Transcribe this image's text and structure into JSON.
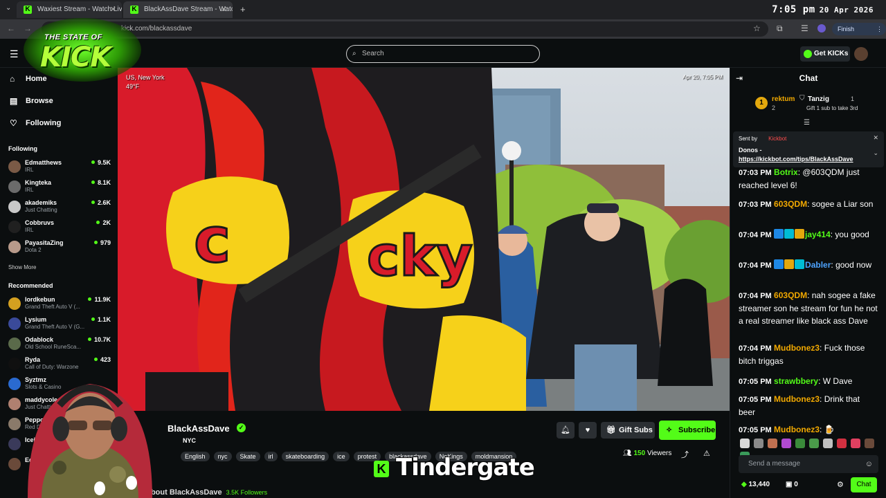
{
  "browser": {
    "tabs": [
      {
        "title": "Waxiest Stream - Watch Live"
      },
      {
        "title": "BlackAssDave Stream - Watch L"
      }
    ],
    "url": "kick.com/blackassdave",
    "finish_update": "Finish update",
    "clock_time": "7:05 pm",
    "clock_date": "20 Apr 2026"
  },
  "overlay_logo": {
    "top": "THE STATE OF",
    "big": "KICK"
  },
  "header": {
    "search_placeholder": "Search",
    "get_kicks": "Get KICKs"
  },
  "sidebar": {
    "nav": [
      {
        "label": "Home",
        "icon": "home-icon"
      },
      {
        "label": "Browse",
        "icon": "browse-icon"
      },
      {
        "label": "Following",
        "icon": "heart-icon"
      }
    ],
    "following_title": "Following",
    "following": [
      {
        "name": "Edmatthews",
        "category": "IRL",
        "viewers": "9.5K",
        "color": "#7a5a46"
      },
      {
        "name": "Kingteka",
        "category": "IRL",
        "viewers": "8.1K",
        "color": "#6b6b6b"
      },
      {
        "name": "akademiks",
        "category": "Just Chatting",
        "viewers": "2.6K",
        "color": "#c8c8c8"
      },
      {
        "name": "Cobbruvs",
        "category": "IRL",
        "viewers": "2K",
        "color": "#202020"
      },
      {
        "name": "PayasitaZing",
        "category": "Dota 2",
        "viewers": "979",
        "color": "#b89a8a"
      }
    ],
    "show_more": "Show More",
    "recommended_title": "Recommended",
    "recommended": [
      {
        "name": "lordkebun",
        "category": "Grand Theft Auto V (...",
        "viewers": "11.9K",
        "color": "#d4a020"
      },
      {
        "name": "Lysium",
        "category": "Grand Theft Auto V (G...",
        "viewers": "1.1K",
        "color": "#3a4a9a"
      },
      {
        "name": "Odablock",
        "category": "Old School RuneSca...",
        "viewers": "10.7K",
        "color": "#5a6a4a"
      },
      {
        "name": "Ryda",
        "category": "Call of Duty: Warzone",
        "viewers": "423",
        "color": "#101010"
      },
      {
        "name": "Syztmz",
        "category": "Slots & Casino",
        "viewers": "",
        "color": "#2a6ad0"
      },
      {
        "name": "maddycoles",
        "category": "Just Chatting",
        "viewers": "",
        "color": "#b08070"
      },
      {
        "name": "Peppo",
        "category": "Red Dead...",
        "viewers": "",
        "color": "#8a7a6a"
      },
      {
        "name": "Iceing",
        "category": "",
        "viewers": "",
        "color": "#3a3a5a"
      },
      {
        "name": "Ed",
        "category": "",
        "viewers": "",
        "color": "#6a4a3a"
      }
    ]
  },
  "video": {
    "location": "US, New York",
    "temp": "49°F",
    "timestamp": "Apr 20, 7:05 PM"
  },
  "stream": {
    "streamer": "BlackAssDave",
    "title": "NYC",
    "tags": [
      "English",
      "nyc",
      "Skate",
      "irl",
      "skateboarding",
      "ice",
      "protest",
      "blackassdave",
      "NoKings",
      "moldmansion"
    ],
    "gift_subs": "Gift Subs",
    "subscribe": "Subscribe",
    "viewers_count": "150",
    "viewers_label": "Viewers",
    "about": "About BlackAssDave",
    "followers": "3.5K Followers"
  },
  "caption": "Tindergate",
  "chat": {
    "title": "Chat",
    "leaderboard": [
      {
        "rank": "1",
        "name": "rektum",
        "count": "2"
      },
      {
        "name": "Tanzig",
        "count": "1",
        "note": "Gift 1 sub to take 3rd"
      }
    ],
    "pinned": {
      "sent_by": "Sent by",
      "bot_name": "Kickbot",
      "donos": "Donos -",
      "link": "https://kickbot.com/tips/BlackAssDave"
    },
    "messages": [
      {
        "time": "07:03 PM",
        "user": "Botrix",
        "color": "#53fc18",
        "text": "@603QDM just reached level 6!",
        "badges": []
      },
      {
        "time": "07:03 PM",
        "user": "603QDM",
        "color": "#f2a900",
        "text": "sogee a Liar son",
        "badges": []
      },
      {
        "time": "07:04 PM",
        "user": "jay414",
        "color": "#53fc18",
        "text": "you good",
        "badges": [
          "#1e88e5",
          "#00bcd4",
          "#e3a80d"
        ]
      },
      {
        "time": "07:04 PM",
        "user": "Dabler",
        "color": "#4da3ff",
        "text": "good now",
        "badges": [
          "#1e88e5",
          "#e3a80d",
          "#00bcd4"
        ]
      },
      {
        "time": "07:04 PM",
        "user": "603QDM",
        "color": "#f2a900",
        "text": "nah sogee a fake streamer son he stream for fun he not a real streamer like black ass Dave",
        "badges": []
      },
      {
        "time": "07:04 PM",
        "user": "Mudbonez3",
        "color": "#f2a900",
        "text": "Fuck those bitch triggas",
        "badges": []
      },
      {
        "time": "07:05 PM",
        "user": "strawbbery",
        "color": "#53fc18",
        "text": "W Dave",
        "badges": []
      },
      {
        "time": "07:05 PM",
        "user": "Mudbonez3",
        "color": "#f2a900",
        "text": "Drink that beer",
        "badges": []
      },
      {
        "time": "07:05 PM",
        "user": "Mudbonez3",
        "color": "#f2a900",
        "text": "🍺",
        "badges": []
      }
    ],
    "send_placeholder": "Send a message",
    "points": "13,440",
    "subs": "0",
    "chat_button": "Chat"
  }
}
